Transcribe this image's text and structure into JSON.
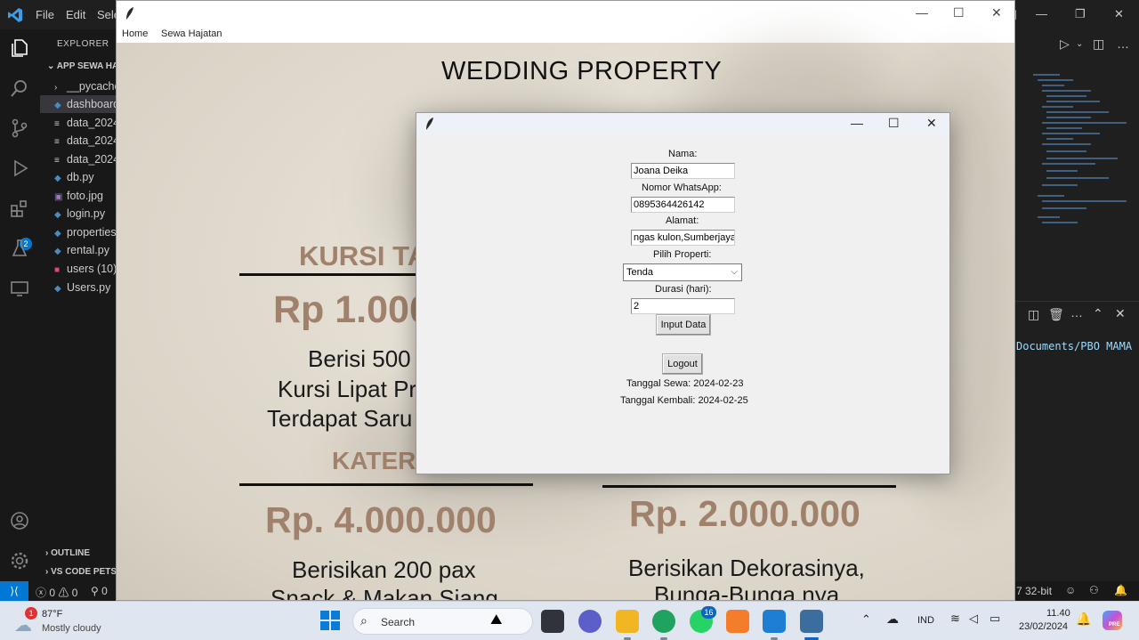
{
  "vscode": {
    "menu": [
      "File",
      "Edit",
      "Sele"
    ],
    "explorer_label": "EXPLORER",
    "folder_label": "APP SEWA HA",
    "files": [
      {
        "label": "__pycache",
        "icon": "chevron-right-icon"
      },
      {
        "label": "dashboard",
        "icon": "python-file-icon",
        "selected": true
      },
      {
        "label": "data_2024",
        "icon": "text-file-icon"
      },
      {
        "label": "data_2024",
        "icon": "text-file-icon"
      },
      {
        "label": "data_2024",
        "icon": "text-file-icon"
      },
      {
        "label": "db.py",
        "icon": "python-file-icon"
      },
      {
        "label": "foto.jpg",
        "icon": "image-file-icon"
      },
      {
        "label": "login.py",
        "icon": "python-file-icon"
      },
      {
        "label": "properties",
        "icon": "python-file-icon"
      },
      {
        "label": "rental.py",
        "icon": "python-file-icon"
      },
      {
        "label": "users (10)",
        "icon": "database-file-icon"
      },
      {
        "label": "Users.py",
        "icon": "python-file-icon"
      }
    ],
    "outline_label": "OUTLINE",
    "vscode_pets_label": "VS CODE PETS",
    "source_control_badge": "2",
    "status": {
      "errors": "0",
      "warnings": "0",
      "ports": "0",
      "python_version": "7 32-bit"
    },
    "terminal_path": "Documents/PBO MAMA"
  },
  "app": {
    "menu_home": "Home",
    "menu_sewa": "Sewa Hajatan",
    "canvas": {
      "title": "WEDDING PROPERTY",
      "kursi_heading": "KURSI TA",
      "kursi_price": "Rp 1.000",
      "kursi_desc_1": "Berisi 500",
      "kursi_desc_2": "Kursi Lipat Pr",
      "kursi_desc_3": "Terdapat Saru",
      "katering_heading": "KATER",
      "katering_price": "Rp. 4.000.000",
      "katering_desc_1": "Berisikan 200 pax",
      "katering_desc_2": "Snack & Makan Siang",
      "dekor_price": "Rp. 2.000.000",
      "dekor_desc_1": "Berisikan Dekorasinya,",
      "dekor_desc_2": "Bunga-Bunga nya"
    }
  },
  "dialog": {
    "nama_label": "Nama:",
    "nama_value": "Joana Deika",
    "wa_label": "Nomor WhatsApp:",
    "wa_value": "0895364426142",
    "alamat_label": "Alamat:",
    "alamat_value": "ngas kulon,Sumberjaya",
    "properti_label": "Pilih Properti:",
    "properti_value": "Tenda",
    "durasi_label": "Durasi (hari):",
    "durasi_value": "2",
    "input_button": "Input Data",
    "logout_button": "Logout",
    "tanggal_sewa": "Tanggal Sewa: 2024-02-23",
    "tanggal_kembali": "Tanggal Kembali: 2024-02-25"
  },
  "taskbar": {
    "weather_badge": "1",
    "temperature": "87°F",
    "weather": "Mostly cloudy",
    "search_label": "Search",
    "whatsapp_badge": "16",
    "language": "IND",
    "time": "11.40",
    "date": "23/02/2024",
    "copilot_label": "PRE"
  }
}
